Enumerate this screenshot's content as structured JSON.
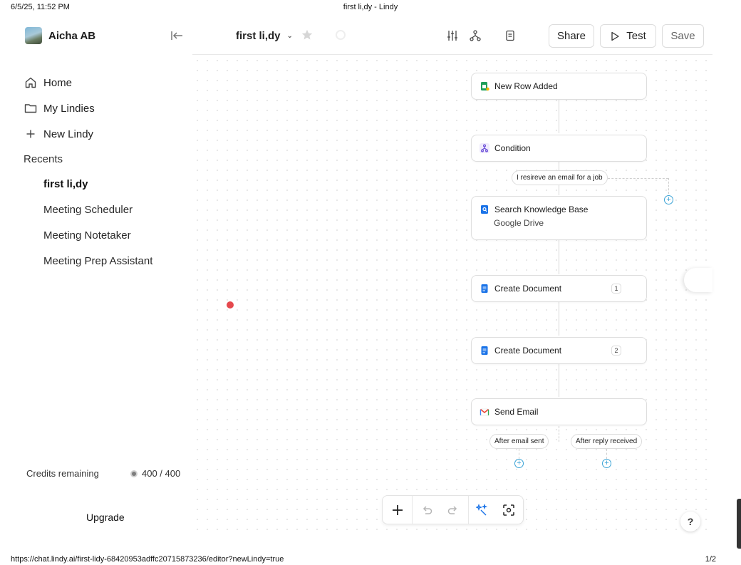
{
  "print_header": {
    "date": "6/5/25, 11:52 PM",
    "title": "first li,dy - Lindy"
  },
  "print_footer": {
    "url": "https://chat.lindy.ai/first-lidy-68420953adffc20715873236/editor?newLindy=true",
    "page": "1/2"
  },
  "sidebar": {
    "user_name": "Aicha AB",
    "nav": [
      {
        "label": "Home",
        "icon": "home-icon"
      },
      {
        "label": "My Lindies",
        "icon": "folder-icon"
      },
      {
        "label": "New Lindy",
        "icon": "plus-icon"
      }
    ],
    "recents_title": "Recents",
    "recents": [
      {
        "label": "first li,dy",
        "active": true
      },
      {
        "label": "Meeting Scheduler"
      },
      {
        "label": "Meeting Notetaker"
      },
      {
        "label": "Meeting Prep Assistant"
      }
    ],
    "credits_label": "Credits remaining",
    "credits_value": "400 / 400",
    "upgrade_label": "Upgrade"
  },
  "topbar": {
    "flow_title": "first li,dy",
    "share_label": "Share",
    "test_label": "Test",
    "save_label": "Save"
  },
  "flow": {
    "nodes": [
      {
        "label": "New Row Added",
        "icon": "google-sheets-icon"
      },
      {
        "label": "Condition",
        "icon": "condition-icon"
      },
      {
        "label": "Search Knowledge Base",
        "sublabel": "Google Drive",
        "icon": "knowledge-base-icon"
      },
      {
        "label": "Create Document",
        "badge": "1",
        "icon": "google-docs-icon"
      },
      {
        "label": "Create Document",
        "badge": "2",
        "icon": "google-docs-icon"
      },
      {
        "label": "Send Email",
        "icon": "gmail-icon"
      }
    ],
    "condition_pill": "I resireve an email for a job",
    "email_branches": [
      "After email sent",
      "After reply received"
    ]
  },
  "help_label": "?",
  "colors": {
    "accent": "#3ba3d6",
    "recording_dot": "#e5484d"
  }
}
